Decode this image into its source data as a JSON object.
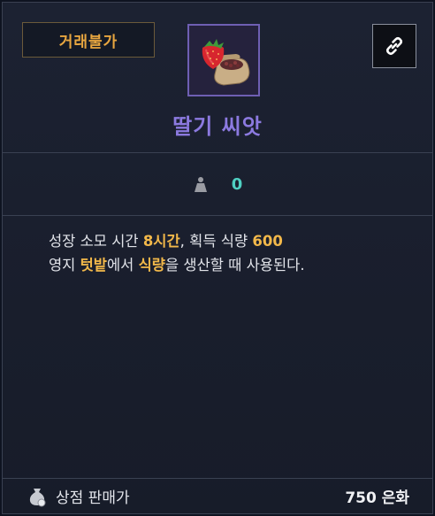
{
  "badge": {
    "label": "거래불가"
  },
  "item": {
    "name": "딸기 씨앗",
    "icon": "strawberry-seed-icon"
  },
  "link_button": {
    "icon": "link-icon"
  },
  "stat": {
    "icon": "weight-icon",
    "value": "0"
  },
  "description": {
    "line1": {
      "part1": "성장 소모 시간 ",
      "hl1": "8시간",
      "part2": ", 획득 식량 ",
      "hl2": "600"
    },
    "line2": {
      "part1": "영지 ",
      "hl1": "텃밭",
      "part2": "에서 ",
      "hl2": "식량",
      "part3": "을 생산할 때 사용된다."
    }
  },
  "footer": {
    "icon": "money-bag-icon",
    "label": "상점 판매가",
    "price": "750 은화"
  },
  "colors": {
    "badge_text": "#e8a640",
    "item_name": "#8c7ae0",
    "stat_value": "#4fd0c2",
    "highlight": "#f2b84a"
  }
}
